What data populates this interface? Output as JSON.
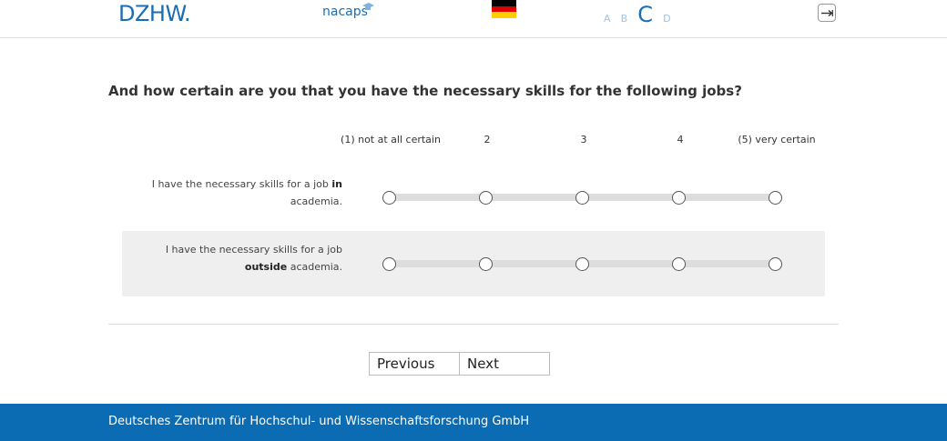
{
  "header": {
    "logo_dzhw": "DZHW.",
    "logo_nacaps": "nacaps",
    "flag_colors": [
      "#000000",
      "#dd0000",
      "#ffce00"
    ],
    "font_size_options": [
      "A",
      "B",
      "C",
      "D"
    ],
    "selected_font_size": "C",
    "logout_icon": "logout-arrow-icon"
  },
  "question": {
    "text": "And how certain are you that you have the necessary skills for the following jobs?",
    "scale_labels": [
      "(1) not at all certain",
      "2",
      "3",
      "4",
      "(5) very certain"
    ],
    "items": [
      {
        "label_pre": "I have the necessary skills for a job ",
        "label_bold": "in",
        "label_post": " academia."
      },
      {
        "label_pre": "I have the necessary skills for a job ",
        "label_bold": "outside",
        "label_post": " academia."
      }
    ]
  },
  "navigation": {
    "previous_label": "Previous",
    "next_label": "Next"
  },
  "footer": {
    "text": "Deutsches Zentrum für Hochschul- und Wissenschaftsforschung GmbH"
  },
  "colors": {
    "brand_blue": "#1a6db3",
    "footer_blue": "#0b6cb3",
    "row_alt_bg": "#efefef"
  }
}
